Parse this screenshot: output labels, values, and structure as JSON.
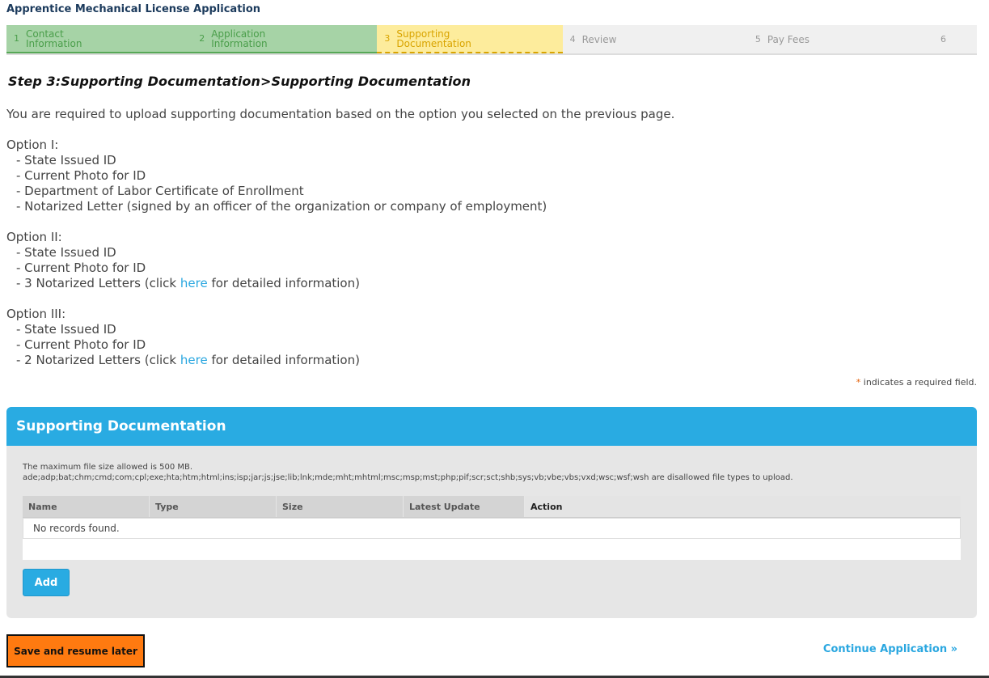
{
  "app": {
    "title": "Apprentice Mechanical License Application"
  },
  "steps": [
    {
      "num": "1",
      "label_line1": "Contact",
      "label_line2": "Information",
      "state": "done"
    },
    {
      "num": "2",
      "label_line1": "Application",
      "label_line2": "Information",
      "state": "done"
    },
    {
      "num": "3",
      "label_line1": "Supporting",
      "label_line2": "Documentation",
      "state": "current"
    },
    {
      "num": "4",
      "label_line1": "Review",
      "label_line2": "",
      "state": "todo"
    },
    {
      "num": "5",
      "label_line1": "Pay Fees",
      "label_line2": "",
      "state": "todo"
    },
    {
      "num": "6",
      "label_line1": "",
      "label_line2": "",
      "state": "todo"
    }
  ],
  "page": {
    "heading": "Step 3:Supporting Documentation>Supporting Documentation",
    "intro": "You are required to upload supporting documentation based on the option you selected on the previous page.",
    "option1": {
      "title": "Option I:",
      "items": [
        "- State Issued ID",
        "- Current Photo for ID",
        "- Department of Labor Certificate of Enrollment",
        "- Notarized Letter (signed by an officer of the organization or company of employment)"
      ]
    },
    "option2": {
      "title": "Option II:",
      "items": [
        "- State Issued ID",
        "- Current Photo for ID"
      ],
      "letters_prefix": "- 3 Notarized Letters (click ",
      "link": "here",
      "letters_suffix": " for detailed information)"
    },
    "option3": {
      "title": "Option III:",
      "items": [
        "- State Issued ID",
        "- Current Photo for ID"
      ],
      "letters_prefix": "- 2 Notarized Letters (click ",
      "link": "here",
      "letters_suffix": " for detailed information)"
    },
    "required_star": "*",
    "required_note": " indicates a required field."
  },
  "section": {
    "title": "Supporting Documentation",
    "max_size": "The maximum file size allowed is 500 MB.",
    "disallowed": "ade;adp;bat;chm;cmd;com;cpl;exe;hta;htm;html;ins;isp;jar;js;jse;lib;lnk;mde;mht;mhtml;msc;msp;mst;php;pif;scr;sct;shb;sys;vb;vbe;vbs;vxd;wsc;wsf;wsh are disallowed file types to upload.",
    "columns": [
      "Name",
      "Type",
      "Size",
      "Latest Update",
      "Action"
    ],
    "empty": "No records found.",
    "add_label": "Add"
  },
  "footer": {
    "save_label": "Save and resume later",
    "continue_label": "Continue Application »"
  },
  "colors": {
    "accent": "#29abe2",
    "done": "#a6d3a6",
    "current": "#fdec9c",
    "save": "#ff7a10"
  }
}
